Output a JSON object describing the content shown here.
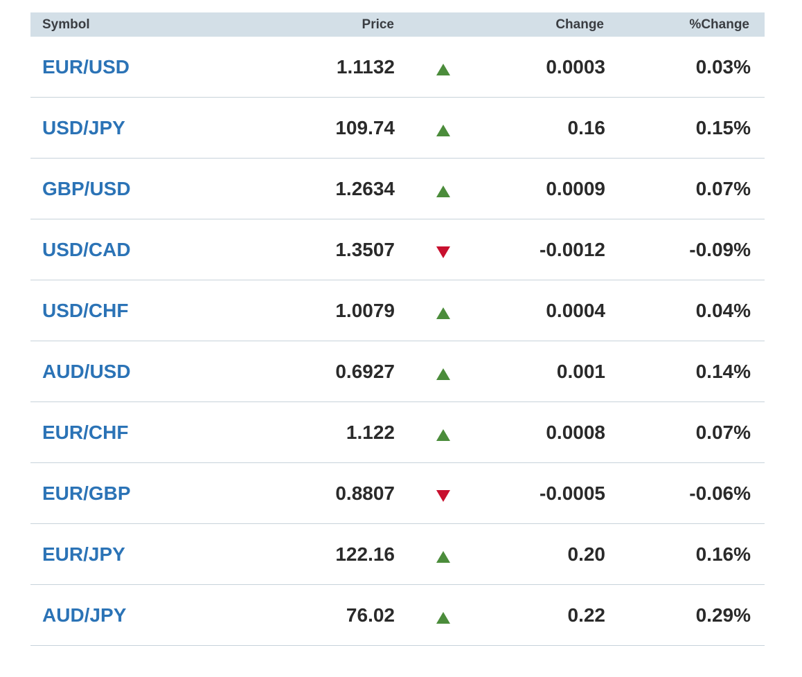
{
  "header": {
    "symbol": "Symbol",
    "price": "Price",
    "change": "Change",
    "pct_change": "%Change"
  },
  "colors": {
    "link": "#2b73b6",
    "up": "#4b8c3b",
    "down": "#c8102e",
    "header_bg": "#d3dfe7"
  },
  "rows": [
    {
      "symbol": "EUR/USD",
      "price": "1.1132",
      "direction": "up",
      "change": "0.0003",
      "pct": "0.03%"
    },
    {
      "symbol": "USD/JPY",
      "price": "109.74",
      "direction": "up",
      "change": "0.16",
      "pct": "0.15%"
    },
    {
      "symbol": "GBP/USD",
      "price": "1.2634",
      "direction": "up",
      "change": "0.0009",
      "pct": "0.07%"
    },
    {
      "symbol": "USD/CAD",
      "price": "1.3507",
      "direction": "down",
      "change": "-0.0012",
      "pct": "-0.09%"
    },
    {
      "symbol": "USD/CHF",
      "price": "1.0079",
      "direction": "up",
      "change": "0.0004",
      "pct": "0.04%"
    },
    {
      "symbol": "AUD/USD",
      "price": "0.6927",
      "direction": "up",
      "change": "0.001",
      "pct": "0.14%"
    },
    {
      "symbol": "EUR/CHF",
      "price": "1.122",
      "direction": "up",
      "change": "0.0008",
      "pct": "0.07%"
    },
    {
      "symbol": "EUR/GBP",
      "price": "0.8807",
      "direction": "down",
      "change": "-0.0005",
      "pct": "-0.06%"
    },
    {
      "symbol": "EUR/JPY",
      "price": "122.16",
      "direction": "up",
      "change": "0.20",
      "pct": "0.16%"
    },
    {
      "symbol": "AUD/JPY",
      "price": "76.02",
      "direction": "up",
      "change": "0.22",
      "pct": "0.29%"
    }
  ]
}
